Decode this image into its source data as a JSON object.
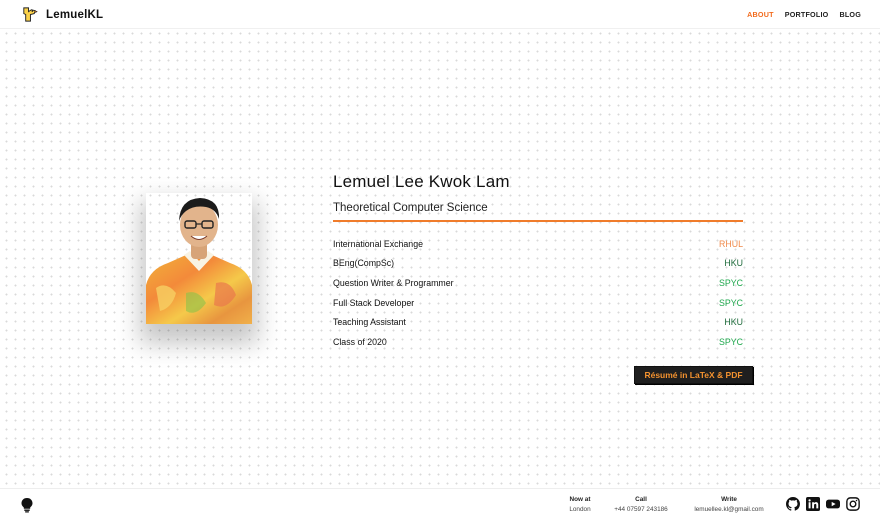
{
  "header": {
    "brand": "LemuelKL",
    "nav": [
      {
        "label": "ABOUT",
        "active": true
      },
      {
        "label": "PORTFOLIO",
        "active": false
      },
      {
        "label": "BLOG",
        "active": false
      }
    ]
  },
  "profile": {
    "name": "Lemuel Lee Kwok Lam",
    "subtitle": "Theoretical Computer Science",
    "rows": [
      {
        "role": "International Exchange",
        "org": "RHUL"
      },
      {
        "role": "BEng(CompSc)",
        "org": "HKU"
      },
      {
        "role": "Question Writer & Programmer",
        "org": "SPYC"
      },
      {
        "role": "Full Stack Developer",
        "org": "SPYC"
      },
      {
        "role": "Teaching Assistant",
        "org": "HKU"
      },
      {
        "role": "Class of 2020",
        "org": "SPYC"
      }
    ],
    "resume_button": "Résumé in LaTeX & PDF"
  },
  "footer": {
    "now_at": {
      "label": "Now at",
      "value": "London"
    },
    "call": {
      "label": "Call",
      "value": "+44 07597 243186"
    },
    "write": {
      "label": "Write",
      "value": "lemuellee.kl@gmail.com"
    },
    "socials": [
      "github-icon",
      "linkedin-icon",
      "youtube-icon",
      "instagram-icon"
    ]
  },
  "colors": {
    "accent": "#f26b1d",
    "divider": "#f07c2b",
    "org_green": "#1fa84d",
    "org_orange": "#f08a4b",
    "org_dark_green": "#1d6a3a",
    "button_bg": "#1f1f1f",
    "button_text": "#f3922f"
  }
}
